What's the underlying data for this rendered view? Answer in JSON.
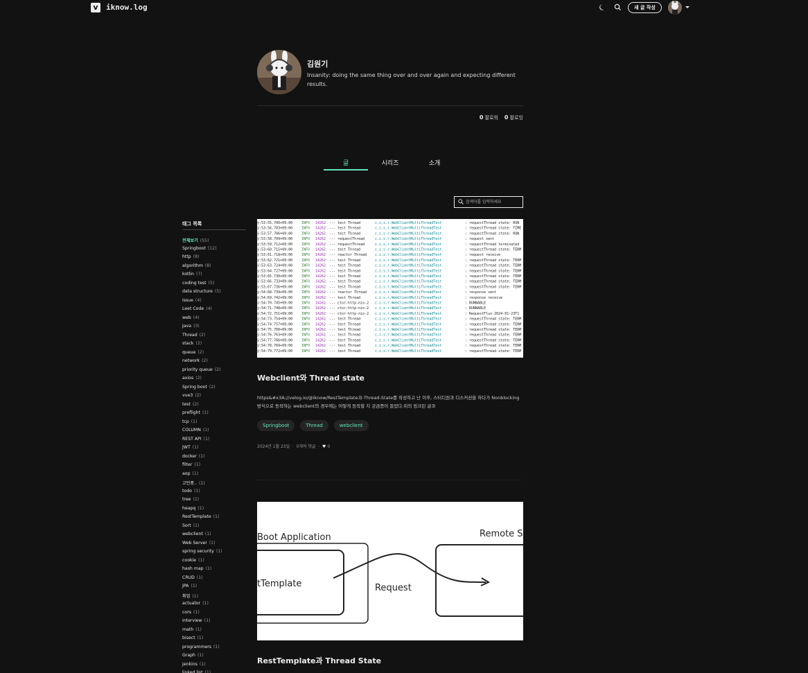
{
  "header": {
    "logo_letter": "v",
    "blog_name": "iknow.log",
    "new_post_label": "새 글 작성",
    "icons": [
      "moon-icon",
      "search-icon",
      "avatar",
      "caret-down-icon"
    ]
  },
  "profile": {
    "name": "김원기",
    "bio": "Insanity: doing the same thing over and over again and expecting different results.",
    "followers_count": "0",
    "followers_label": "팔로워",
    "following_count": "0",
    "following_label": "팔로잉"
  },
  "tabs": [
    {
      "label": "글",
      "active": true
    },
    {
      "label": "시리즈",
      "active": false
    },
    {
      "label": "소개",
      "active": false
    }
  ],
  "search": {
    "placeholder": "검색어를 입력하세요"
  },
  "tags": {
    "title": "태그 목록",
    "items": [
      {
        "label": "전체보기",
        "count": "(55)"
      },
      {
        "label": "Springboot",
        "count": "(12)"
      },
      {
        "label": "http",
        "count": "(8)"
      },
      {
        "label": "algorithm",
        "count": "(8)"
      },
      {
        "label": "kotlin",
        "count": "(7)"
      },
      {
        "label": "coding test",
        "count": "(5)"
      },
      {
        "label": "data structure",
        "count": "(5)"
      },
      {
        "label": "issue",
        "count": "(4)"
      },
      {
        "label": "Leet Code",
        "count": "(4)"
      },
      {
        "label": "web",
        "count": "(4)"
      },
      {
        "label": "Java",
        "count": "(3)"
      },
      {
        "label": "Thread",
        "count": "(2)"
      },
      {
        "label": "stack",
        "count": "(2)"
      },
      {
        "label": "queue",
        "count": "(2)"
      },
      {
        "label": "network",
        "count": "(2)"
      },
      {
        "label": "priority queue",
        "count": "(2)"
      },
      {
        "label": "axios",
        "count": "(2)"
      },
      {
        "label": "Spring boot",
        "count": "(2)"
      },
      {
        "label": "vue3",
        "count": "(2)"
      },
      {
        "label": "test",
        "count": "(2)"
      },
      {
        "label": "preflight",
        "count": "(1)"
      },
      {
        "label": "tcp",
        "count": "(1)"
      },
      {
        "label": "COLUMN",
        "count": "(1)"
      },
      {
        "label": "REST API",
        "count": "(1)"
      },
      {
        "label": "JWT",
        "count": "(1)"
      },
      {
        "label": "docker",
        "count": "(1)"
      },
      {
        "label": "filter",
        "count": "(1)"
      },
      {
        "label": "aop",
        "count": "(1)"
      },
      {
        "label": "고민중..",
        "count": "(1)"
      },
      {
        "label": "todo",
        "count": "(1)"
      },
      {
        "label": "tree",
        "count": "(1)"
      },
      {
        "label": "heapq",
        "count": "(1)"
      },
      {
        "label": "RestTemplate",
        "count": "(1)"
      },
      {
        "label": "Sort",
        "count": "(1)"
      },
      {
        "label": "webclient",
        "count": "(1)"
      },
      {
        "label": "Web Server",
        "count": "(1)"
      },
      {
        "label": "spring security",
        "count": "(1)"
      },
      {
        "label": "cookie",
        "count": "(1)"
      },
      {
        "label": "hash map",
        "count": "(1)"
      },
      {
        "label": "CRUD",
        "count": "(1)"
      },
      {
        "label": "JPA",
        "count": "(1)"
      },
      {
        "label": "취업",
        "count": "(1)"
      },
      {
        "label": "actuator",
        "count": "(1)"
      },
      {
        "label": "cors",
        "count": "(1)"
      },
      {
        "label": "interview",
        "count": "(1)"
      },
      {
        "label": "math",
        "count": "(1)"
      },
      {
        "label": "bisect",
        "count": "(1)"
      },
      {
        "label": "programmers",
        "count": "(1)"
      },
      {
        "label": "Graph",
        "count": "(1)"
      },
      {
        "label": "jenkins",
        "count": "(1)"
      },
      {
        "label": "linked list",
        "count": "(1)"
      }
    ]
  },
  "posts": [
    {
      "title": "Webclient와 Thread state",
      "description": "https&#x3A;//velog.io/@iknow/RestTemplate과-Thread-State를 작성하고 난 이후, 스터디원과 디스커션을 하다가 Nonblocking방식으로 동작하는 webclient의 경우에는 어떻게 동작할 지 궁금증이 들었다.위의 링크된 글과",
      "tags": [
        "Springboot",
        "Thread",
        "webclient"
      ],
      "date": "2024년 1월 23일",
      "comments": "0개의 댓글",
      "likes": "0",
      "log_thread_names": [
        "test Thread",
        "test Thread",
        "test Thread",
        "requestThread",
        "requestThread",
        "test Thread",
        "reactor Thread",
        "test Thread",
        "test Thread",
        "test Thread",
        "test Thread",
        "test Thread",
        "test Thread",
        "reactor Thread",
        "test Thread",
        "ctor-http-nio-2",
        "ctor-http-nio-2",
        "ctor-http-nio-2",
        "test Thread",
        "test Thread",
        "test Thread",
        "test Thread",
        "test Thread",
        "test Thread",
        "test Thread"
      ],
      "log_messages": [
        ": requestThread state: RUN",
        ": requestThread state: TIME",
        ": requestThread state: RUN",
        ": request sent",
        ": requestThread terminated",
        ": requestThread state: TERM",
        ": request receive",
        ": requestThread state: TERM",
        ": requestThread state: TERM",
        ": requestThread state: TERM",
        ": requestThread state: TERM",
        ": requestThread state: TERM",
        ": requestThread state: TERM",
        ": response sent",
        ": response receive",
        ": RUNNABLE",
        ": RUNNABLE",
        ": RequestFlux-2024-01-23T1",
        ": requestThread state: TERM",
        ": requestThread state: TERM",
        ": requestThread state: TERM",
        ": requestThread state: TERM",
        ": requestThread state: TERM",
        ": requestThread state: TERM",
        ": requestThread state: TERM"
      ]
    },
    {
      "title": "RestTemplate과 Thread State",
      "diagram_labels": {
        "left_box": "Boot Application",
        "left_inner": "tTemplate",
        "arrow": "Request",
        "right_box": "Remote Se"
      }
    }
  ]
}
